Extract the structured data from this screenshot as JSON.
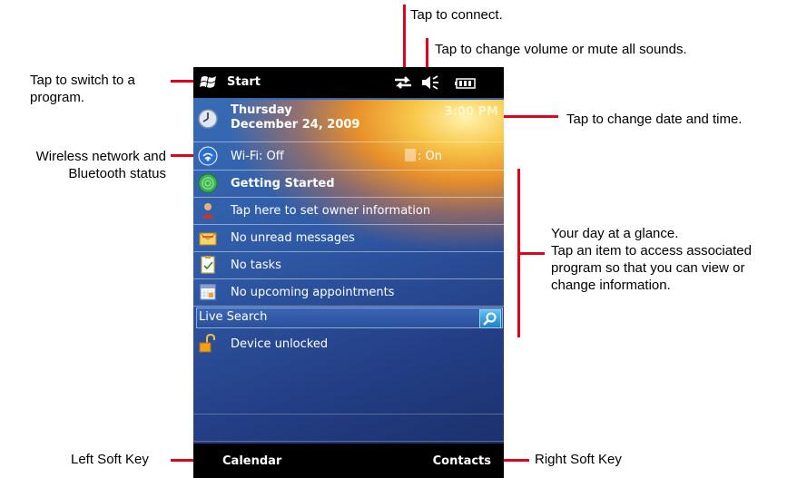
{
  "annotations": {
    "switch_program": "Tap to switch to a program.",
    "switch_program_line1": "Tap to switch to a",
    "switch_program_line2": "program.",
    "connect": "Tap to connect.",
    "volume": "Tap to change volume or mute all sounds.",
    "datetime": "Tap to change date and time.",
    "wireless_line1": "Wireless network and",
    "wireless_line2": "Bluetooth status",
    "day_line1": "Your day at a glance.",
    "day_line2": "Tap an item to access associated",
    "day_line3": "program so that you can view or",
    "day_line4": "change information.",
    "left_soft_key": "Left Soft Key",
    "right_soft_key": "Right Soft Key"
  },
  "phone": {
    "title_bar": {
      "start_label": "Start",
      "icons": [
        "windows-flag-icon",
        "connectivity-icon",
        "speaker-muted-icon",
        "battery-icon"
      ]
    },
    "date": {
      "day": "Thursday",
      "full_date": "December 24, 2009",
      "time": "3:00 PM"
    },
    "wireless": {
      "wifi": "Wi-Fi: Off",
      "bluetooth": ": On"
    },
    "items": {
      "getting_started": "Getting Started",
      "owner": "Tap here to set owner information",
      "messages": "No unread messages",
      "tasks": "No tasks",
      "appointments": "No upcoming appointments"
    },
    "search": {
      "label": "Live Search"
    },
    "device": {
      "status": "Device unlocked"
    },
    "soft_keys": {
      "left": "Calendar",
      "right": "Contacts"
    }
  },
  "colors": {
    "callout": "#e4001b",
    "title_bar": "#000000",
    "background_blue": "#2f5aa6",
    "glow": "#f8c84a"
  }
}
